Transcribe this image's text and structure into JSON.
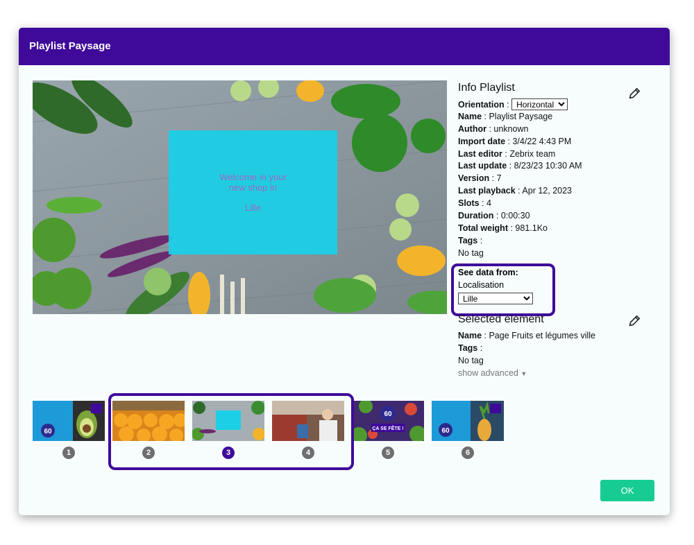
{
  "window": {
    "title": "Playlist Paysage"
  },
  "preview": {
    "overlay_line1": "Welcome in your",
    "overlay_line2": "new shop in",
    "overlay_city": "Lille"
  },
  "info": {
    "title": "Info Playlist",
    "orientation_label": "Orientation",
    "orientation_value": "Horizontal",
    "fields": [
      {
        "label": "Name",
        "value": "Playlist Paysage"
      },
      {
        "label": "Author",
        "value": "unknown"
      },
      {
        "label": "Import date",
        "value": "3/4/22 4:43 PM"
      },
      {
        "label": "Last editor",
        "value": "Zebrix team"
      },
      {
        "label": "Last update",
        "value": "8/23/23 10:30 AM"
      },
      {
        "label": "Version",
        "value": "7"
      },
      {
        "label": "Last playback",
        "value": "Apr 12, 2023"
      },
      {
        "label": "Slots",
        "value": "4"
      },
      {
        "label": "Duration",
        "value": "0:00:30"
      },
      {
        "label": "Total weight",
        "value": "981.1Ko"
      }
    ],
    "tags_label": "Tags",
    "tags_value": "No tag",
    "see_data_label": "See data from:",
    "localisation_label": "Localisation",
    "localisation_value": "Lille"
  },
  "selected": {
    "title": "Selected element",
    "name_label": "Name",
    "name_value": "Page Fruits et légumes ville",
    "tags_label": "Tags",
    "tags_value": "No tag",
    "show_advanced": "show advanced"
  },
  "slides": [
    {
      "num": "1",
      "active": false
    },
    {
      "num": "2",
      "active": false
    },
    {
      "num": "3",
      "active": true
    },
    {
      "num": "4",
      "active": false
    },
    {
      "num": "5",
      "active": false
    },
    {
      "num": "6",
      "active": false
    }
  ],
  "thumb_texts": {
    "badge_text": "60",
    "party_text": "ÇA SE FÊTE !"
  },
  "buttons": {
    "ok": "OK"
  },
  "colors": {
    "header": "#3f0a9a",
    "accent": "#3f0a9a",
    "ok": "#17cc93",
    "overlay": "#1ccfe6"
  }
}
